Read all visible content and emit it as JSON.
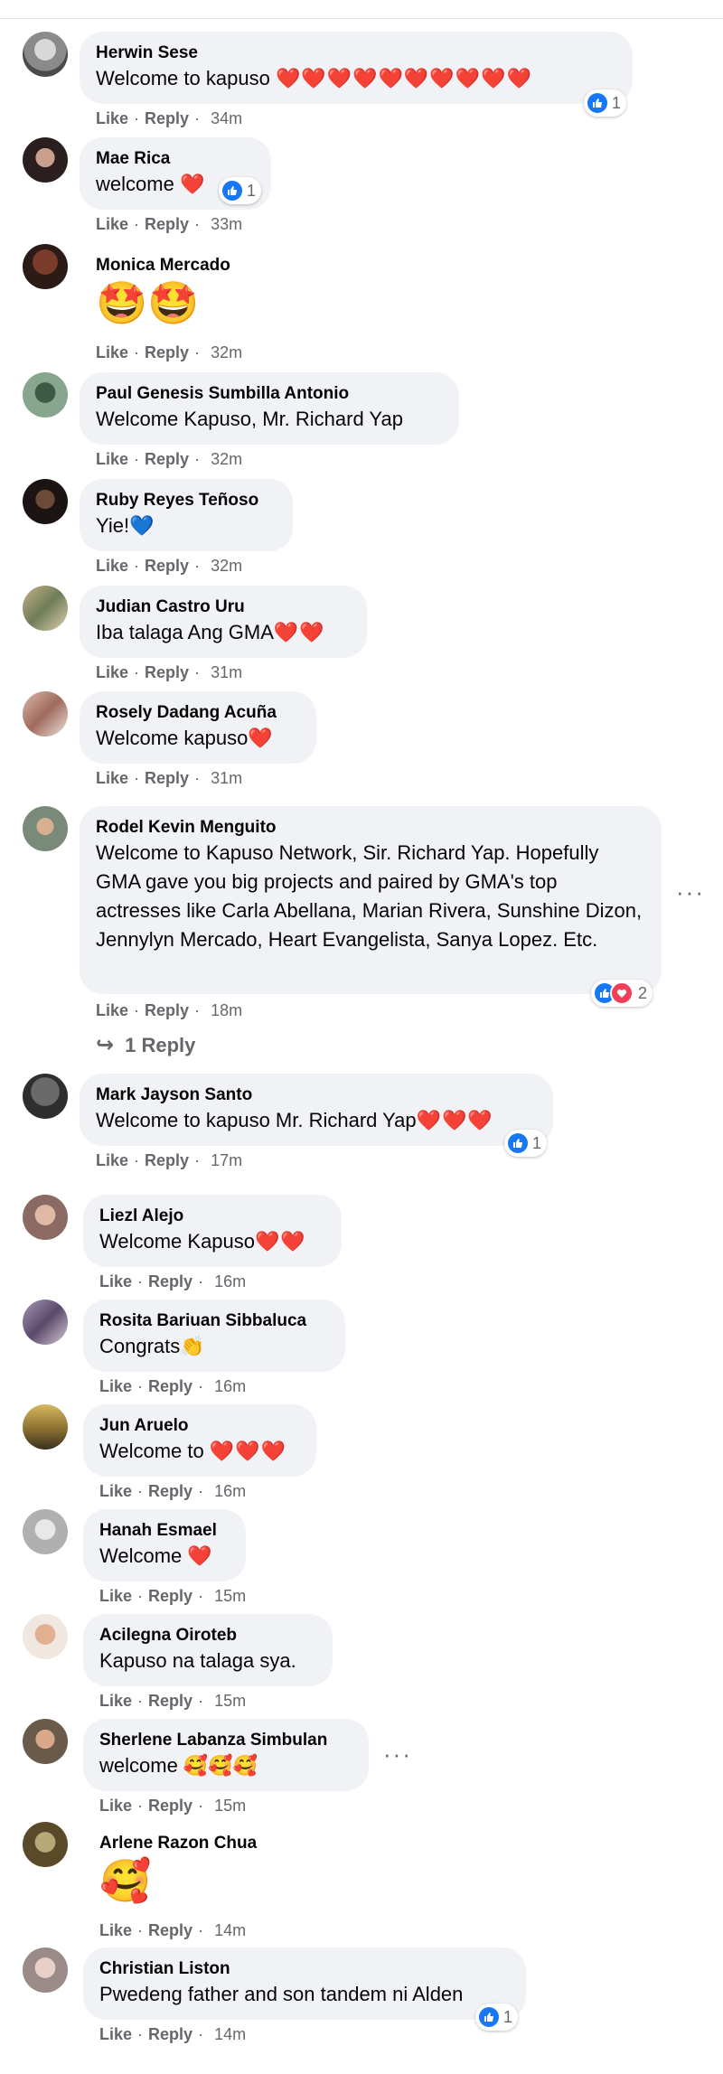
{
  "actions": {
    "like": "Like",
    "reply": "Reply",
    "separator": "·"
  },
  "more_label": "···",
  "comments": [
    {
      "name": "Herwin Sese",
      "text": "Welcome to kapuso",
      "emoji": "❤️❤️❤️❤️❤️❤️❤️❤️❤️❤️",
      "time": "34m",
      "reactions": "1"
    },
    {
      "name": "Mae Rica",
      "text": "welcome",
      "emoji": "❤️",
      "time": "33m",
      "reactions": "1"
    },
    {
      "name": "Monica Mercado",
      "text": "",
      "emoji": "🤩🤩",
      "time": "32m"
    },
    {
      "name": "Paul Genesis Sumbilla Antonio",
      "text": "Welcome Kapuso, Mr. Richard Yap",
      "emoji": "",
      "time": "32m"
    },
    {
      "name": "Ruby Reyes Teñoso",
      "text": "Yie!",
      "emoji": "💙",
      "time": "32m"
    },
    {
      "name": "Judian Castro Uru",
      "text": "Iba talaga Ang GMA",
      "emoji": "❤️❤️",
      "time": "31m"
    },
    {
      "name": "Rosely Dadang Acuña",
      "text": "Welcome kapuso",
      "emoji": "❤️",
      "time": "31m"
    },
    {
      "name": "Rodel Kevin Menguito",
      "text": "Welcome to Kapuso Network, Sir. Richard Yap. Hopefully GMA gave you big projects and paired by GMA's top actresses like Carla Abellana, Marian Rivera, Sunshine Dizon, Jennylyn Mercado, Heart Evangelista, Sanya Lopez. Etc.",
      "emoji": "",
      "time": "18m",
      "reactions": "2",
      "replies": "1 Reply"
    },
    {
      "name": "Mark Jayson Santo",
      "text": "Welcome to kapuso Mr. Richard Yap",
      "emoji": "❤️❤️❤️",
      "time": "17m",
      "reactions": "1"
    },
    {
      "name": "Liezl Alejo",
      "text": "Welcome Kapuso",
      "emoji": "❤️❤️",
      "time": "16m"
    },
    {
      "name": "Rosita Bariuan Sibbaluca",
      "text": "Congrats",
      "emoji": "👏",
      "time": "16m"
    },
    {
      "name": "Jun Aruelo",
      "text": "Welcome to ",
      "emoji": "❤️❤️❤️",
      "time": "16m"
    },
    {
      "name": "Hanah Esmael",
      "text": "Welcome ",
      "emoji": "❤️",
      "time": "15m"
    },
    {
      "name": "Acilegna Oiroteb",
      "text": "Kapuso na talaga sya.",
      "emoji": "",
      "time": "15m"
    },
    {
      "name": "Sherlene Labanza Simbulan",
      "text": "welcome ",
      "emoji": "🥰🥰🥰",
      "time": "15m"
    },
    {
      "name": "Arlene Razon Chua",
      "text": "",
      "emoji": "🥰",
      "time": "14m"
    },
    {
      "name": "Christian Liston",
      "text": "Pwedeng father and son tandem ni Alden",
      "emoji": "",
      "time": "14m",
      "reactions": "1"
    }
  ]
}
